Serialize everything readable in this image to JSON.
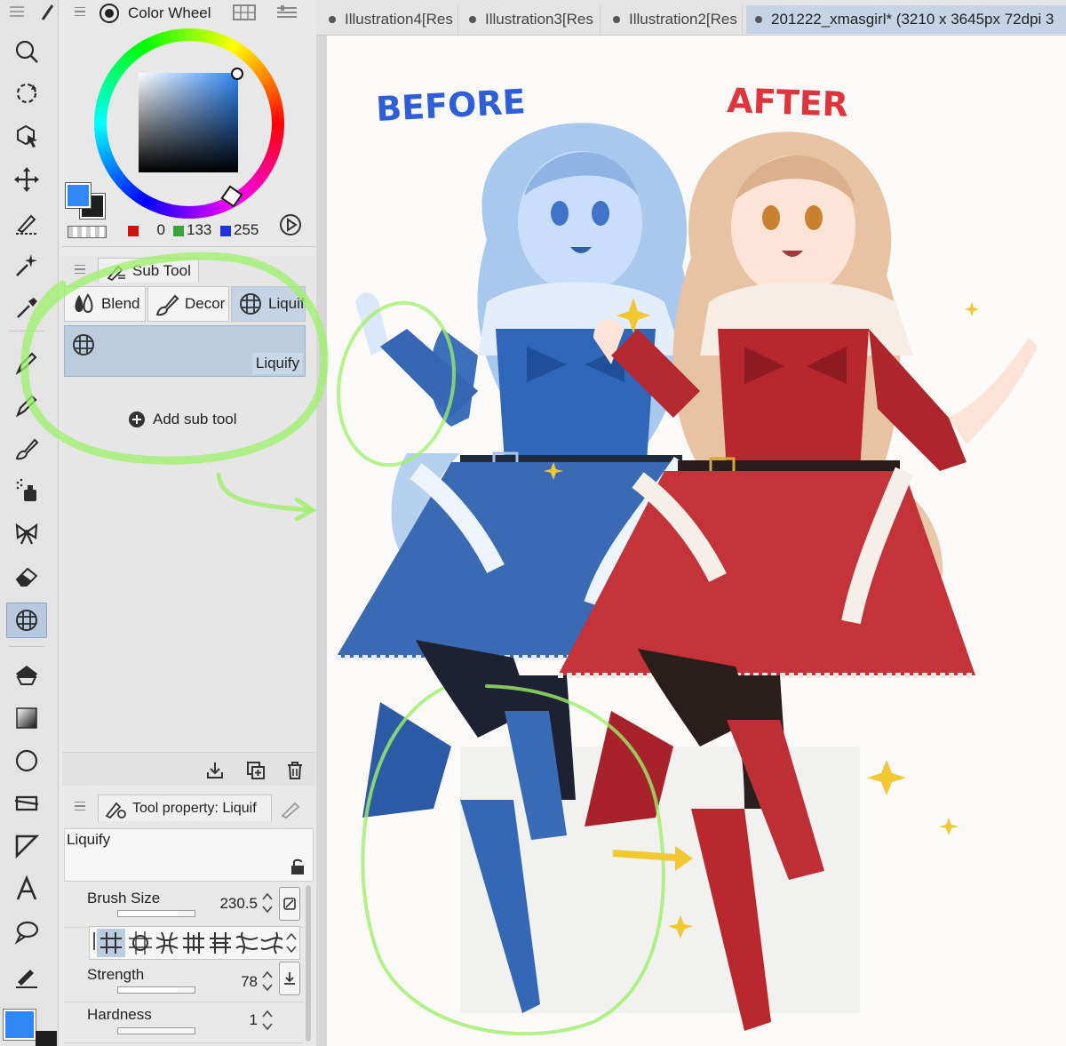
{
  "toolbar": {
    "tools": [
      "zoom-icon",
      "rotate-view-icon",
      "object-select-icon",
      "move-icon",
      "lasso-select-icon",
      "auto-select-wand-icon",
      "eyedropper-icon",
      "pen-icon",
      "pencil-icon",
      "brush-icon",
      "airbrush-icon",
      "decoration-icon",
      "eraser-icon",
      "liquify-icon",
      "fill-icon",
      "gradient-icon",
      "figure-icon",
      "frame-icon",
      "ruler-icon",
      "text-icon",
      "balloon-icon",
      "correction-line-icon"
    ],
    "active_tool": "liquify-icon"
  },
  "color_panel": {
    "title": "Color Wheel",
    "rgb_r": "0",
    "rgb_g": "133",
    "rgb_b": "255",
    "main_color": "#2f86f5",
    "sub_color": "#1e1e1e"
  },
  "sub_tool_panel": {
    "title": "Sub Tool",
    "groups": [
      "Blend",
      "Decor",
      "Liquify"
    ],
    "active_group": "Liquify",
    "selected_item": "Liquify",
    "add_label": "Add sub tool"
  },
  "tool_property": {
    "title": "Tool property: Liquif",
    "tool_name": "Liquify",
    "brush_size_label": "Brush Size",
    "brush_size_value": "230.5",
    "strength_label": "Strength",
    "strength_value": "78",
    "hardness_label": "Hardness",
    "hardness_value": "1",
    "brush_size_fraction": 0.78,
    "strength_fraction": 0.78,
    "hardness_fraction": 0.02
  },
  "document_tabs": [
    {
      "label": "Illustration4[Res",
      "active": false
    },
    {
      "label": "Illustration3[Res",
      "active": false
    },
    {
      "label": "Illustration2[Res",
      "active": false
    },
    {
      "label": "201222_xmasgirl* (3210 x 3645px 72dpi 3",
      "active": true
    }
  ],
  "canvas": {
    "before_label": "BEFORE",
    "after_label": "AFTER",
    "before_color": "#2f5fd8",
    "after_color": "#e0343c",
    "highlight_color": "#9df06a"
  }
}
